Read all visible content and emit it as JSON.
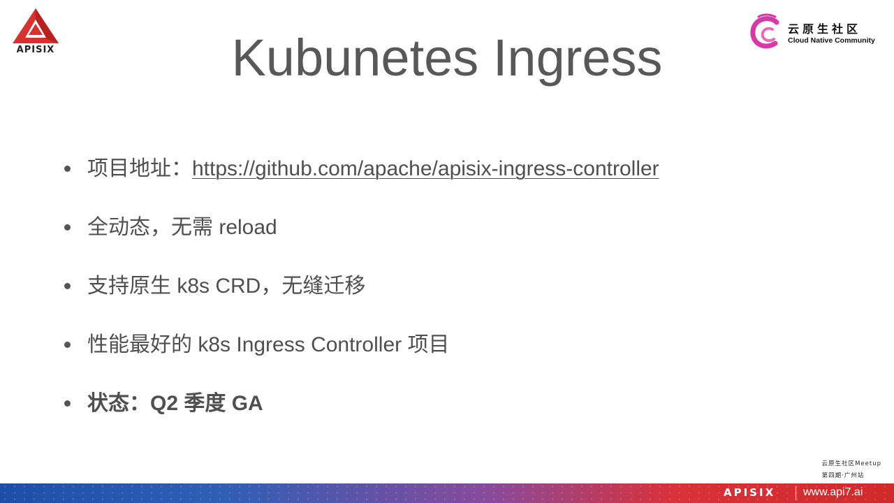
{
  "header": {
    "logo_left_text": "APISIX",
    "logo_right_cn": "云原生社区",
    "logo_right_en": "Cloud Native Community"
  },
  "slide": {
    "title": "Kubunetes Ingress",
    "bullets": [
      {
        "prefix": "项目地址：",
        "link": "https://github.com/apache/apisix-ingress-controller"
      },
      {
        "text": "全动态，无需 reload"
      },
      {
        "text": "支持原生 k8s CRD，无缝迁移"
      },
      {
        "text": "性能最好的 k8s Ingress Controller 项目"
      },
      {
        "text": "状态：Q2 季度 GA",
        "bold": true
      }
    ]
  },
  "footer": {
    "meetup_line1": "云原生社区Meetup",
    "meetup_line2": "第四期·广州站",
    "brand": "APISIX",
    "site": "www.api7.ai"
  },
  "colors": {
    "title": "#585858",
    "text": "#4f4f4f",
    "logo_red": "#d6322f",
    "community_magenta": "#d63aa8",
    "band_blue": "#1e4fa8",
    "band_red": "#d12a2a"
  }
}
